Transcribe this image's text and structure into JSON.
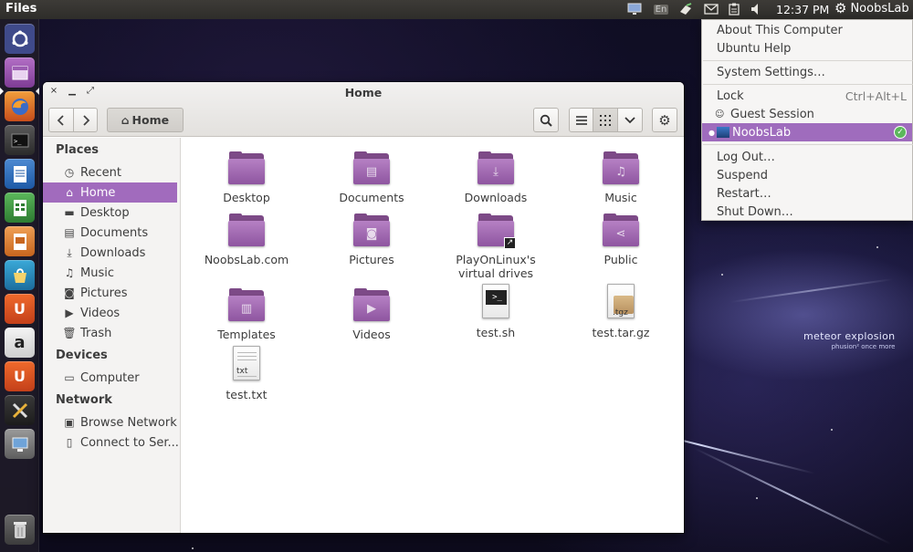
{
  "top_panel": {
    "app_title": "Files",
    "keyboard_layout": "En",
    "clock": "12:37 PM",
    "user": "NoobsLab",
    "indicators": [
      "display-icon",
      "keyboard-layout-icon",
      "network-icon",
      "mail-icon",
      "clipboard-icon",
      "volume-icon",
      "gear-icon"
    ]
  },
  "launcher": {
    "items": [
      "dash-home",
      "files",
      "firefox",
      "terminal",
      "libreoffice-writer",
      "libreoffice-calc",
      "libreoffice-impress",
      "ubuntu-software-center",
      "ubuntu-one",
      "amazon",
      "ubuntu-one-music",
      "system-settings",
      "remote-desktop",
      "trash"
    ]
  },
  "window": {
    "title": "Home",
    "path_label": "Home",
    "controls": {
      "close": "×",
      "minimize": "▁",
      "maximize": "⤢"
    }
  },
  "sidebar": {
    "sections": [
      {
        "heading": "Places",
        "items": [
          "Recent",
          "Home",
          "Desktop",
          "Documents",
          "Downloads",
          "Music",
          "Pictures",
          "Videos",
          "Trash"
        ]
      },
      {
        "heading": "Devices",
        "items": [
          "Computer"
        ]
      },
      {
        "heading": "Network",
        "items": [
          "Browse Network",
          "Connect to Ser..."
        ]
      }
    ],
    "selected": "Home"
  },
  "files": [
    {
      "name": "Desktop",
      "kind": "folder",
      "emblem": ""
    },
    {
      "name": "Documents",
      "kind": "folder",
      "emblem": "▤"
    },
    {
      "name": "Downloads",
      "kind": "folder",
      "emblem": "⤓"
    },
    {
      "name": "Music",
      "kind": "folder",
      "emblem": "♫"
    },
    {
      "name": "NoobsLab.com",
      "kind": "folder",
      "emblem": ""
    },
    {
      "name": "Pictures",
      "kind": "folder",
      "emblem": "◙"
    },
    {
      "name": "PlayOnLinux's",
      "name2": "virtual drives",
      "kind": "folder-link",
      "emblem": ""
    },
    {
      "name": "Public",
      "kind": "folder",
      "emblem": "⋖"
    },
    {
      "name": "Templates",
      "kind": "folder",
      "emblem": "▥"
    },
    {
      "name": "Videos",
      "kind": "folder",
      "emblem": "▶"
    },
    {
      "name": "test.sh",
      "kind": "script",
      "emblem": ">_"
    },
    {
      "name": "test.tar.gz",
      "kind": "archive",
      "emblem": ".tgz"
    },
    {
      "name": "test.txt",
      "kind": "text",
      "emblem": "txt"
    }
  ],
  "user_menu": {
    "items": [
      "About This Computer",
      "Ubuntu Help",
      "System Settings…",
      "Lock",
      "Guest Session",
      "NoobsLab",
      "Log Out…",
      "Suspend",
      "Restart…",
      "Shut Down…"
    ],
    "lock_accel": "Ctrl+Alt+L",
    "active_user": "NoobsLab"
  },
  "wallpaper": {
    "text1": "meteor explosion",
    "text2": "phusion² once more"
  },
  "colors": {
    "accent": "#a16bbd",
    "folder": "#8e55a0",
    "panel": "#3d3b37"
  }
}
